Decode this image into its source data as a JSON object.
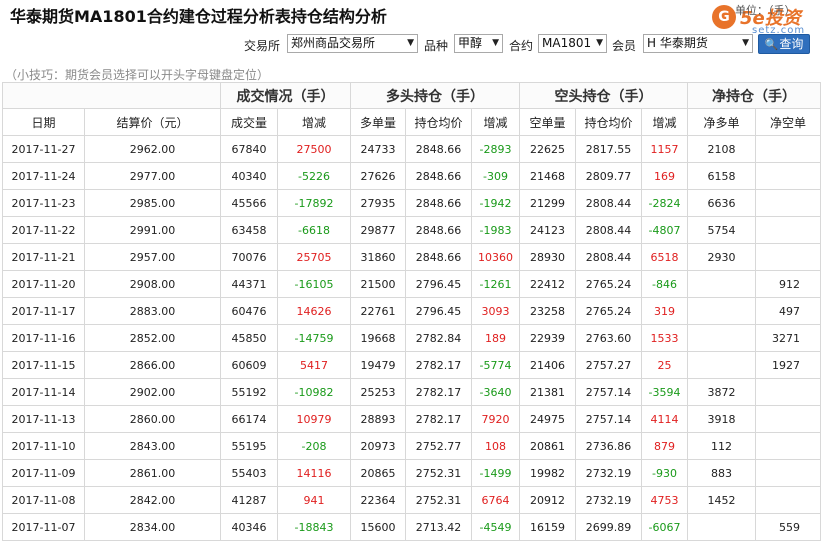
{
  "header": {
    "title": "华泰期货MA1801合约建仓过程分析表持仓结构分析",
    "unit": "单位：（手）",
    "logo_badge": "G",
    "logo_text": "5e投资",
    "logo_sub": "setz.com"
  },
  "filters": {
    "exchange_label": "交易所",
    "exchange_value": "郑州商品交易所",
    "product_label": "品种",
    "product_value": "甲醇",
    "contract_label": "合约",
    "contract_value": "MA1801",
    "member_label": "会员",
    "member_value": "H 华泰期货",
    "query_label": "查询",
    "arrow": "▼",
    "search_glyph": "🔍"
  },
  "tip": "（小技巧：期货会员选择可以开头字母键盘定位）",
  "table": {
    "groups": [
      "成交情况（手）",
      "多头持仓（手）",
      "空头持仓（手）",
      "净持仓（手）"
    ],
    "columns": [
      "日期",
      "结算价（元）",
      "成交量",
      "增减",
      "多单量",
      "持仓均价",
      "增减",
      "空单量",
      "持仓均价",
      "增减",
      "净多单",
      "净空单"
    ],
    "rows": [
      [
        "2017-11-27",
        "2962.00",
        "67840",
        "27500",
        "24733",
        "2848.66",
        "-2893",
        "22625",
        "2817.55",
        "1157",
        "2108",
        ""
      ],
      [
        "2017-11-24",
        "2977.00",
        "40340",
        "-5226",
        "27626",
        "2848.66",
        "-309",
        "21468",
        "2809.77",
        "169",
        "6158",
        ""
      ],
      [
        "2017-11-23",
        "2985.00",
        "45566",
        "-17892",
        "27935",
        "2848.66",
        "-1942",
        "21299",
        "2808.44",
        "-2824",
        "6636",
        ""
      ],
      [
        "2017-11-22",
        "2991.00",
        "63458",
        "-6618",
        "29877",
        "2848.66",
        "-1983",
        "24123",
        "2808.44",
        "-4807",
        "5754",
        ""
      ],
      [
        "2017-11-21",
        "2957.00",
        "70076",
        "25705",
        "31860",
        "2848.66",
        "10360",
        "28930",
        "2808.44",
        "6518",
        "2930",
        ""
      ],
      [
        "2017-11-20",
        "2908.00",
        "44371",
        "-16105",
        "21500",
        "2796.45",
        "-1261",
        "22412",
        "2765.24",
        "-846",
        "",
        "912"
      ],
      [
        "2017-11-17",
        "2883.00",
        "60476",
        "14626",
        "22761",
        "2796.45",
        "3093",
        "23258",
        "2765.24",
        "319",
        "",
        "497"
      ],
      [
        "2017-11-16",
        "2852.00",
        "45850",
        "-14759",
        "19668",
        "2782.84",
        "189",
        "22939",
        "2763.60",
        "1533",
        "",
        "3271"
      ],
      [
        "2017-11-15",
        "2866.00",
        "60609",
        "5417",
        "19479",
        "2782.17",
        "-5774",
        "21406",
        "2757.27",
        "25",
        "",
        "1927"
      ],
      [
        "2017-11-14",
        "2902.00",
        "55192",
        "-10982",
        "25253",
        "2782.17",
        "-3640",
        "21381",
        "2757.14",
        "-3594",
        "3872",
        ""
      ],
      [
        "2017-11-13",
        "2860.00",
        "66174",
        "10979",
        "28893",
        "2782.17",
        "7920",
        "24975",
        "2757.14",
        "4114",
        "3918",
        ""
      ],
      [
        "2017-11-10",
        "2843.00",
        "55195",
        "-208",
        "20973",
        "2752.77",
        "108",
        "20861",
        "2736.86",
        "879",
        "112",
        ""
      ],
      [
        "2017-11-09",
        "2861.00",
        "55403",
        "14116",
        "20865",
        "2752.31",
        "-1499",
        "19982",
        "2732.19",
        "-930",
        "883",
        ""
      ],
      [
        "2017-11-08",
        "2842.00",
        "41287",
        "941",
        "22364",
        "2752.31",
        "6764",
        "20912",
        "2732.19",
        "4753",
        "1452",
        ""
      ],
      [
        "2017-11-07",
        "2834.00",
        "40346",
        "-18843",
        "15600",
        "2713.42",
        "-4549",
        "16159",
        "2699.89",
        "-6067",
        "",
        "559"
      ]
    ]
  },
  "colors": {
    "increase": "#e02020",
    "decrease": "#1a9a1a",
    "accent": "#e8732a",
    "button": "#2f6fbd"
  }
}
